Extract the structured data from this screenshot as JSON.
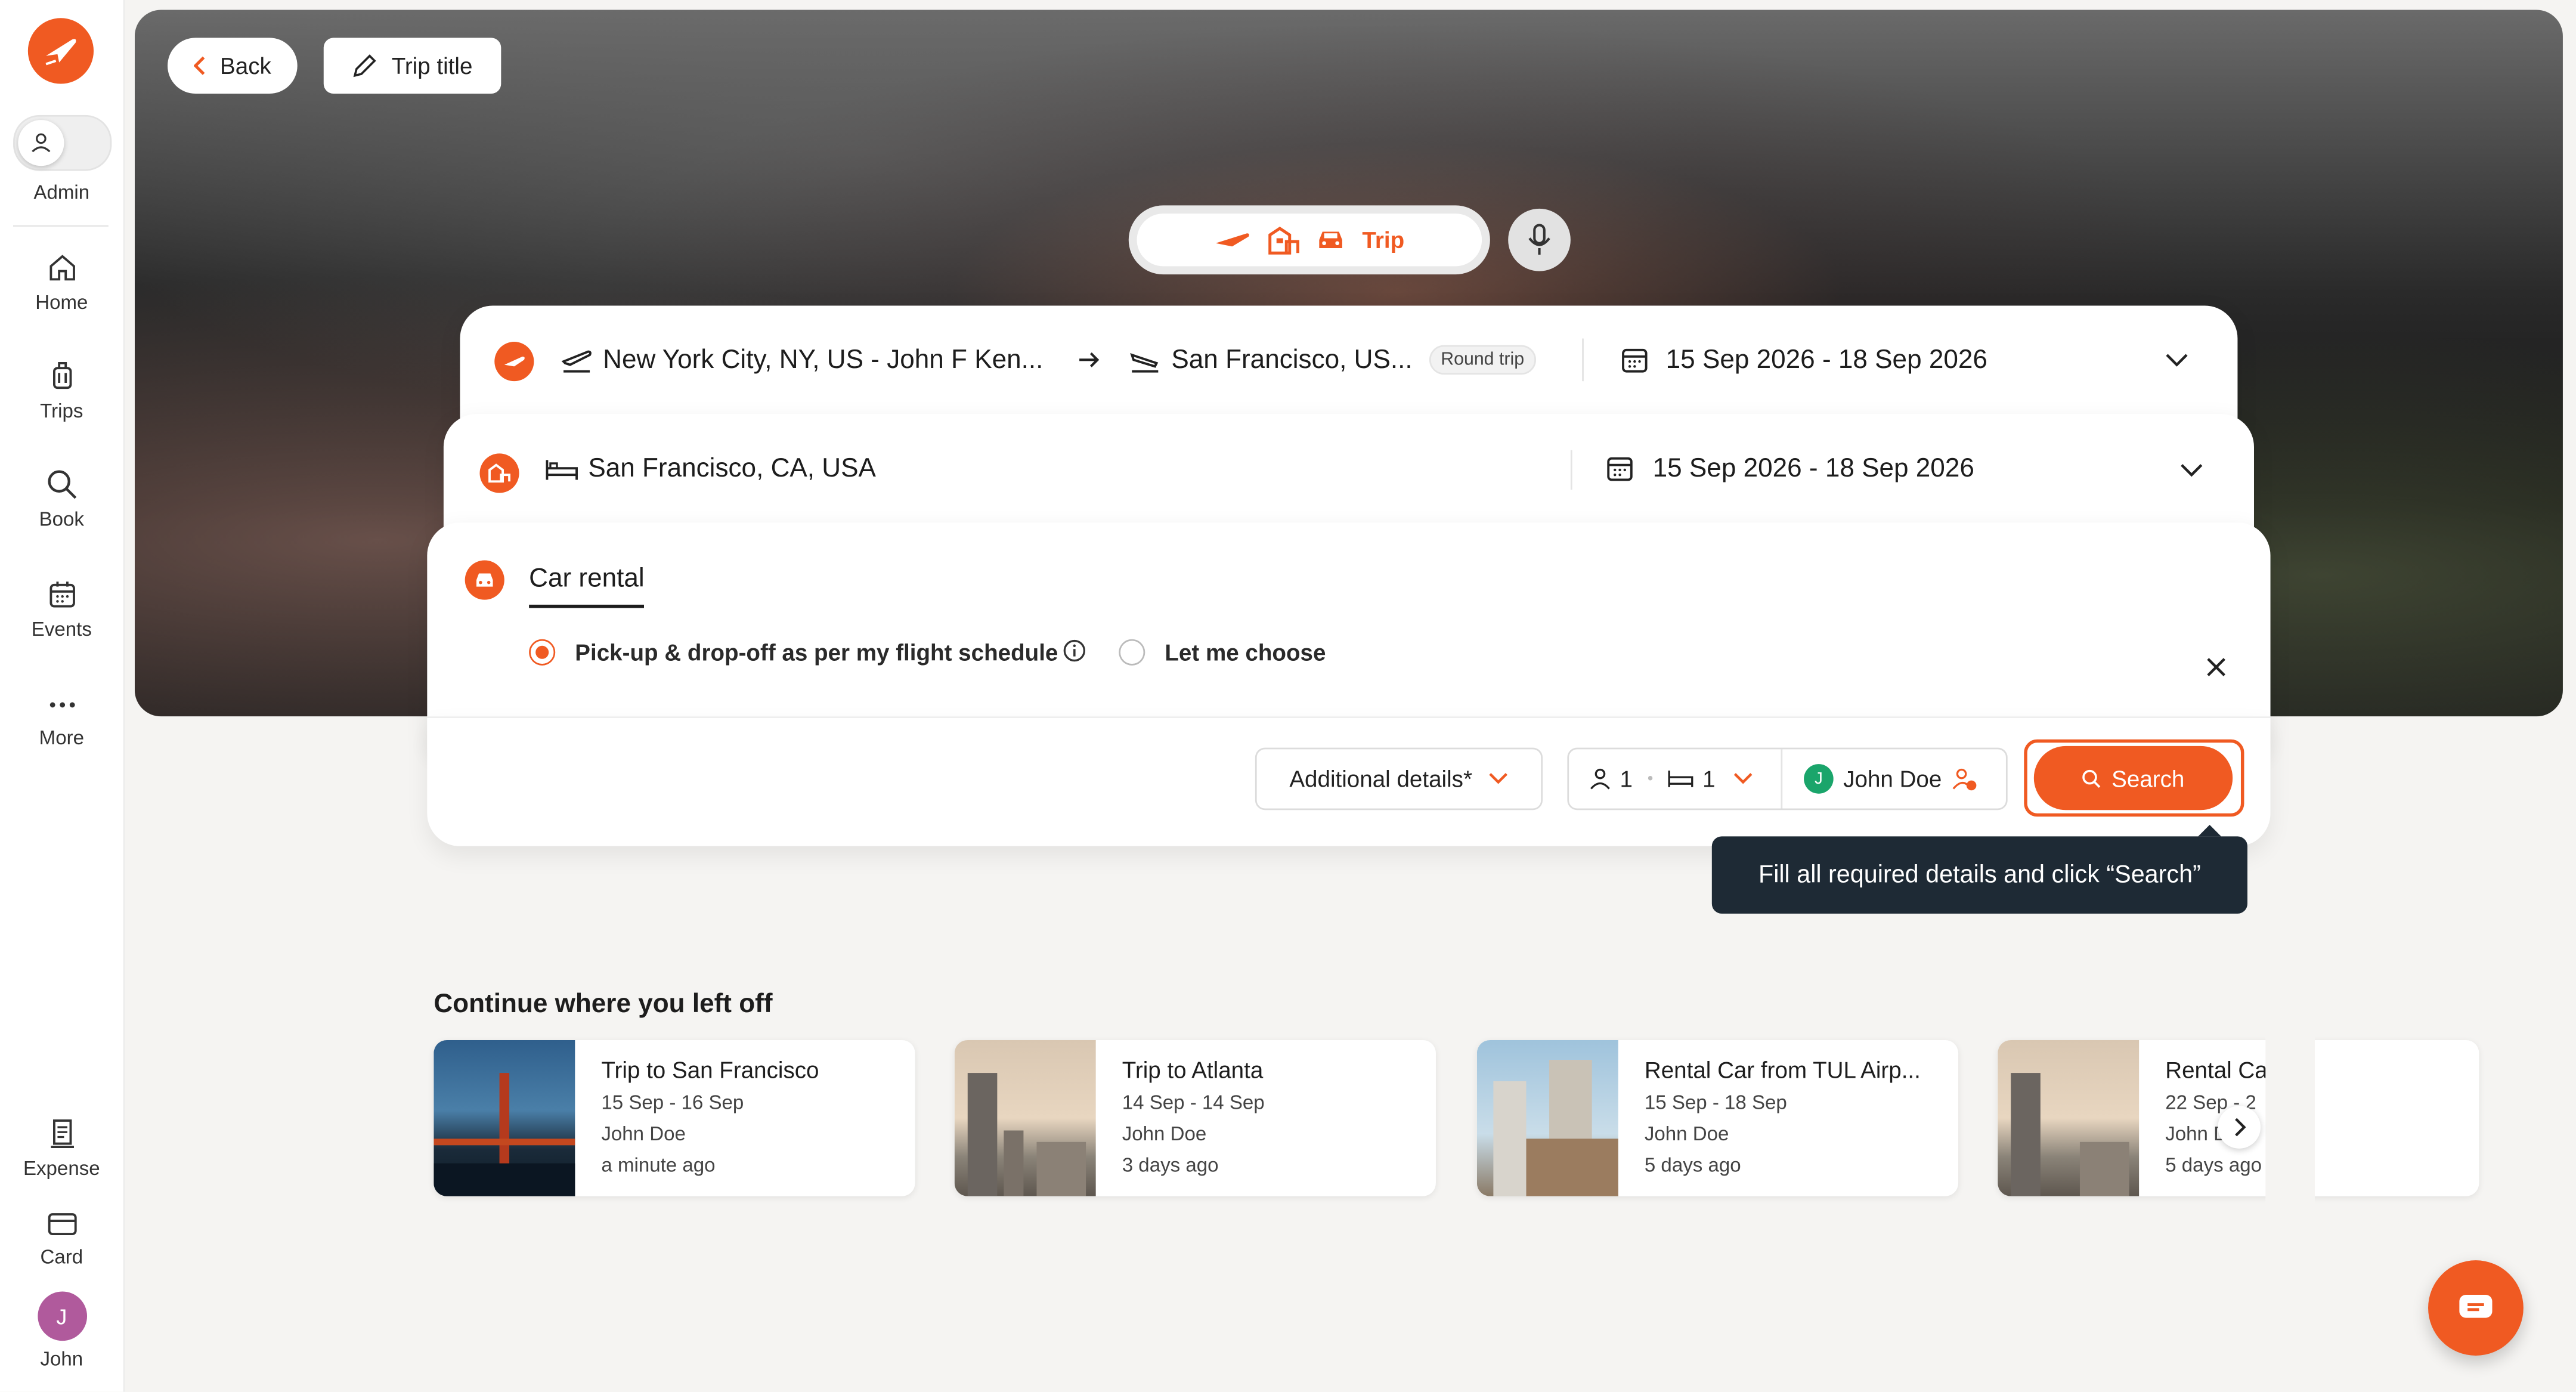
{
  "colors": {
    "brand": "#f05a22",
    "tooltip_bg": "#1e2a35",
    "avatar": "#b05a9c",
    "traveler_avatar": "#1aa56b"
  },
  "sidebar": {
    "admin_label": "Admin",
    "items": [
      {
        "label": "Home",
        "icon": "home-icon"
      },
      {
        "label": "Trips",
        "icon": "luggage-icon"
      },
      {
        "label": "Book",
        "icon": "search-icon"
      },
      {
        "label": "Events",
        "icon": "calendar-icon"
      },
      {
        "label": "More",
        "icon": "more-icon"
      }
    ],
    "bottom_items": [
      {
        "label": "Expense",
        "icon": "receipt-icon"
      },
      {
        "label": "Card",
        "icon": "card-icon"
      }
    ],
    "user": {
      "initial": "J",
      "label": "John"
    }
  },
  "header": {
    "back_label": "Back",
    "trip_title_label": "Trip title"
  },
  "mode_switch": {
    "active_label": "Trip"
  },
  "flight": {
    "origin": "New York City, NY, US - John F Ken...",
    "destination": "San Francisco, US...",
    "trip_type": "Round trip",
    "dates": "15 Sep 2026 - 18 Sep 2026"
  },
  "hotel": {
    "location": "San Francisco, CA, USA",
    "dates": "15 Sep 2026 - 18 Sep 2026"
  },
  "car": {
    "tab_label": "Car rental",
    "option_1": "Pick-up & drop-off as per my flight schedule",
    "option_2": "Let me choose",
    "selected": "option_1"
  },
  "controls": {
    "additional_details": "Additional details*",
    "travelers": "1",
    "rooms": "1",
    "traveler_name": "John Doe",
    "traveler_initial": "J",
    "search_label": "Search",
    "tooltip": "Fill all required details and click “Search”"
  },
  "recent": {
    "title": "Continue where you left off",
    "items": [
      {
        "title": "Trip to San Francisco",
        "dates": "15 Sep - 16 Sep",
        "person": "John Doe",
        "time": "a minute ago"
      },
      {
        "title": "Trip to Atlanta",
        "dates": "14 Sep - 14 Sep",
        "person": "John Doe",
        "time": "3 days ago"
      },
      {
        "title": "Rental Car from TUL Airp...",
        "dates": "15 Sep - 18 Sep",
        "person": "John Doe",
        "time": "5 days ago"
      },
      {
        "title": "Rental Ca",
        "dates": "22 Sep - 2",
        "person": "John D",
        "time": "5 days ago"
      }
    ]
  }
}
